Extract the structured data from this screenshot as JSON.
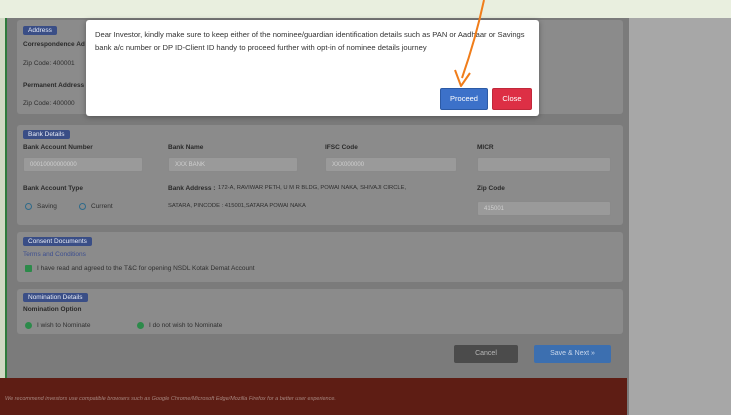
{
  "modal": {
    "message": "Dear Investor, kindly make sure to keep either of the nominee/guardian identification details such as PAN or Aadhaar or Savings bank a/c number or DP ID-Client ID handy to proceed further with opt-in of nominee details journey",
    "proceed_label": "Proceed",
    "close_label": "Close"
  },
  "address": {
    "tag": "Address",
    "correspondence_label": "Correspondence Ad",
    "zip1": "Zip Code: 400001",
    "permanent_label": "Permanent Address",
    "zip2": "Zip Code: 400000"
  },
  "bank": {
    "tag": "Bank Details",
    "account_number_label": "Bank Account Number",
    "account_number_value": "00010000000000",
    "bank_name_label": "Bank Name",
    "bank_name_value": "XXX BANK",
    "ifsc_label": "IFSC Code",
    "ifsc_value": "XXX000000",
    "micr_label": "MICR",
    "micr_value": "",
    "account_type_label": "Bank Account Type",
    "saving_label": "Saving",
    "current_label": "Current",
    "bank_address_label": "Bank Address :",
    "bank_address_line1": "172-A, RAVIWAR PETH, U M R BLDG, POWAI NAKA, SHIVAJI CIRCLE,",
    "bank_address_line2": "SATARA, PINCODE : 415001,SATARA POWAI NAKA",
    "zip_label": "Zip Code",
    "zip_value": "415001"
  },
  "consent": {
    "tag": "Consent Documents",
    "terms_link": "Terms and Conditions",
    "check_text": "I have read and agreed to the T&C for opening NSDL Kotak Demat Account"
  },
  "nomination": {
    "tag": "Nomination Details",
    "option_label": "Nomination Option",
    "option_yes": "I wish to Nominate",
    "option_no": "I do not wish to Nominate"
  },
  "actions": {
    "cancel_label": "Cancel",
    "save_next_label": "Save & Next »"
  },
  "footer": {
    "text": "We recommend investors use compatible browsers such as Google Chrome/Microsoft Edge/Mozilla Firefox for a better user experience."
  },
  "colors": {
    "proceed": "#3c71c9",
    "close": "#dd2f45",
    "annotation_arrow": "#f07d1a",
    "tag_blue": "#3a4e86",
    "footer": "#5e1d14"
  }
}
